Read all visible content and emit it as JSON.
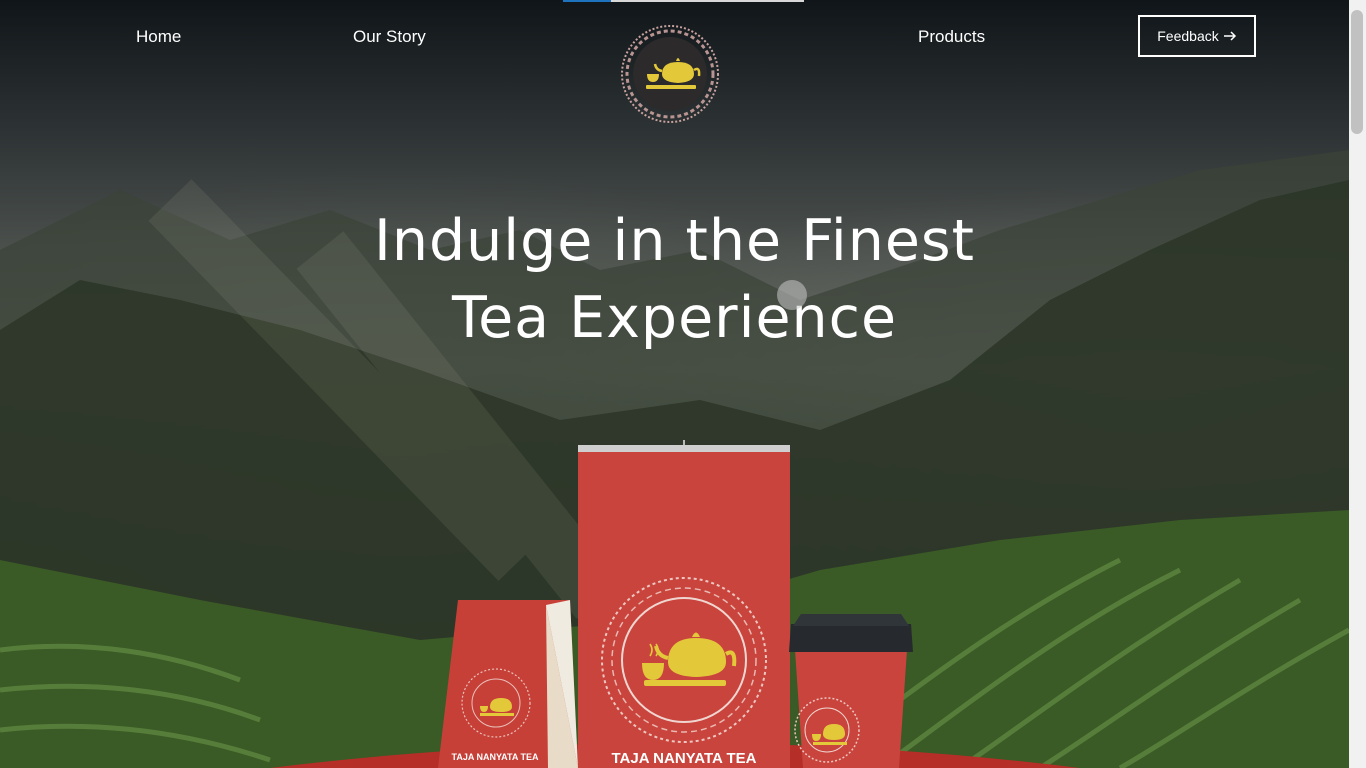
{
  "header": {
    "progress": 0.2,
    "nav": {
      "home": "Home",
      "our_story": "Our Story",
      "products": "Products"
    },
    "feedback_label": "Feedback",
    "feedback_icon": "arrow-right-icon",
    "logo_icon": "teapot-and-cup-icon"
  },
  "hero": {
    "headline_line1": "Indulge in the Finest",
    "headline_line2": "Tea Experience"
  },
  "products": {
    "tall_pack_brand": "TAJA NANYATA TEA",
    "small_pouch_brand": "TAJA NANYATA TEA"
  },
  "colors": {
    "brand_red": "#c9443c",
    "logo_yellow": "#e3c83a",
    "platform_red": "#b52f28"
  }
}
